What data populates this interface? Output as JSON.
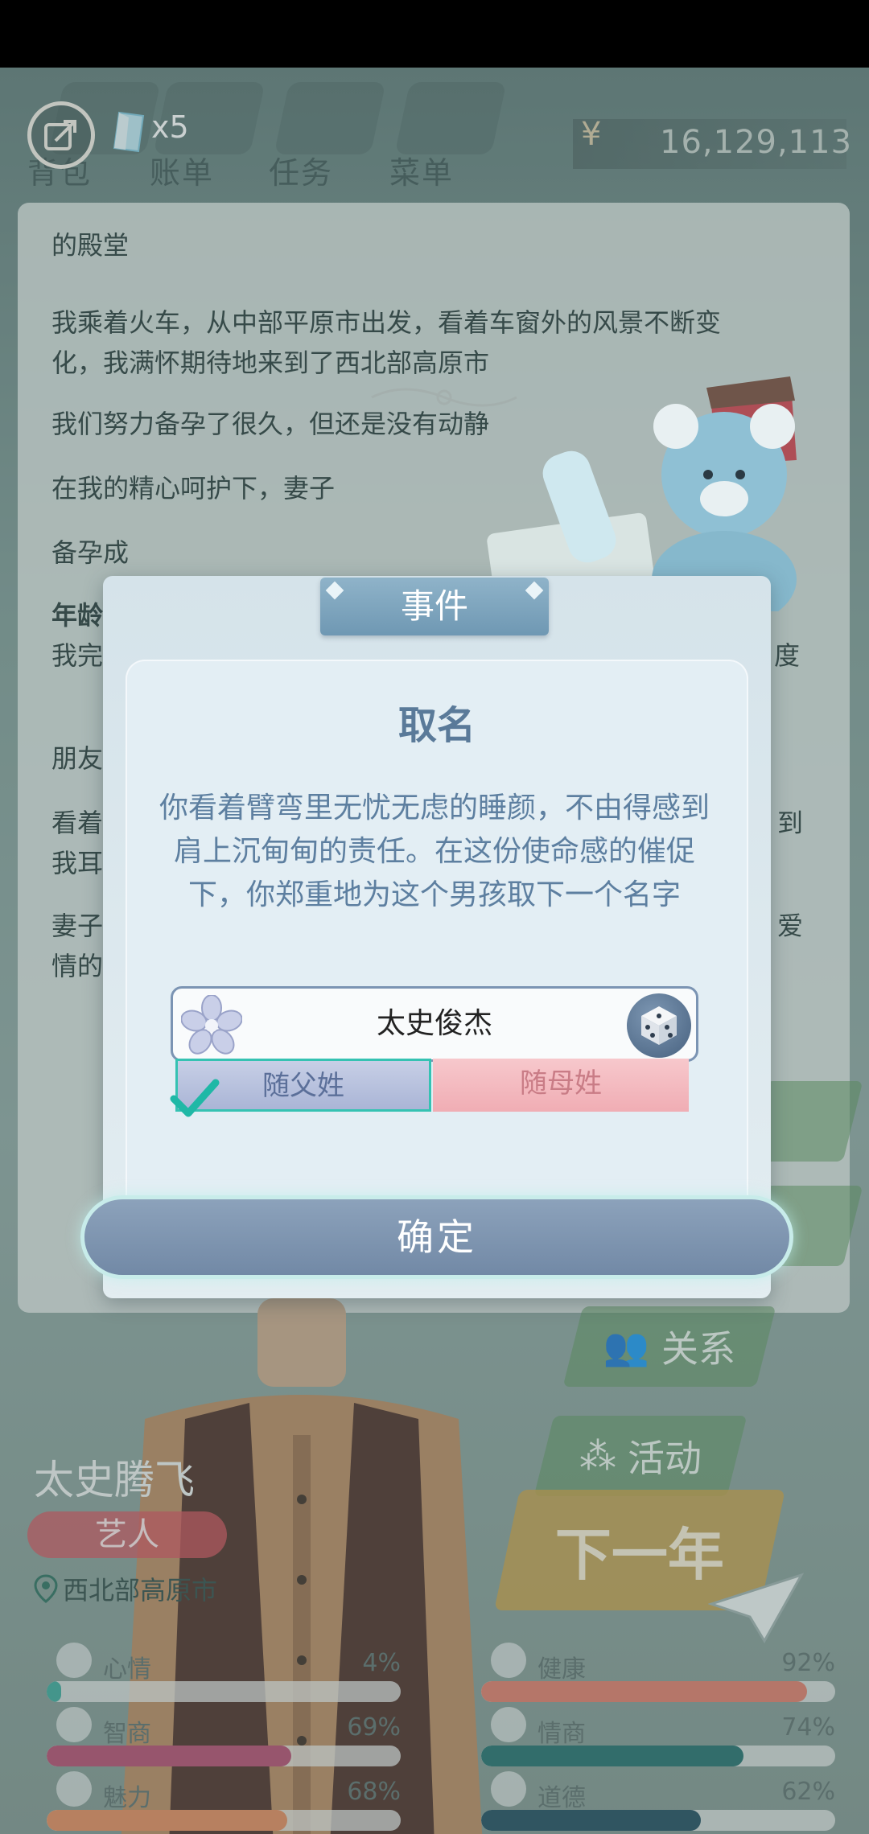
{
  "topbar": {
    "nav": [
      "背包",
      "账单",
      "任务",
      "菜单"
    ],
    "gem_count": "x5",
    "currency_symbol": "¥",
    "money": "16,129,113"
  },
  "story": {
    "lines": [
      "的殿堂",
      "我乘着火车，从中部平原市出发，看着车窗外的风景不断变",
      "化，我满怀期待地来到了西北部高原市",
      "我们努力备孕了很久，但还是没有动静",
      "在我的精心呵护下，妻子",
      "备孕成",
      "年龄",
      "我完",
      "朋友",
      "看着",
      "我耳",
      "妻子",
      "情的"
    ],
    "right_fragments": [
      "度",
      "到",
      "爱"
    ]
  },
  "dialog": {
    "tab": "事件",
    "title": "取名",
    "body": "你看着臂弯里无忧无虑的睡颜，不由得感到肩上沉甸甸的责任。在这份使命感的催促下，你郑重地为这个男孩取下一个名字",
    "name_value": "太史俊杰",
    "father_surname": "随父姓",
    "mother_surname": "随母姓",
    "selected": "father",
    "confirm": "确定"
  },
  "character": {
    "name": "太史腾飞",
    "job": "艺人",
    "location": "西北部高原市"
  },
  "side_buttons": [
    "关系",
    "活动"
  ],
  "next_year": "下一年",
  "stats": [
    {
      "label": "心情",
      "value": "4%",
      "fraction": 0.04,
      "color": "#3aa89a",
      "icon": "smile-icon"
    },
    {
      "label": "健康",
      "value": "92%",
      "fraction": 0.92,
      "color": "#e07b68",
      "icon": "heart-icon"
    },
    {
      "label": "智商",
      "value": "69%",
      "fraction": 0.69,
      "color": "#b44a6e",
      "icon": "lightbulb-icon"
    },
    {
      "label": "情商",
      "value": "74%",
      "fraction": 0.74,
      "color": "#1f6e6a",
      "icon": "apple-icon"
    },
    {
      "label": "魅力",
      "value": "68%",
      "fraction": 0.68,
      "color": "#e48a5a",
      "icon": "sparkle-icon"
    },
    {
      "label": "道德",
      "value": "62%",
      "fraction": 0.62,
      "color": "#1d4a5c",
      "icon": "scale-icon"
    }
  ]
}
